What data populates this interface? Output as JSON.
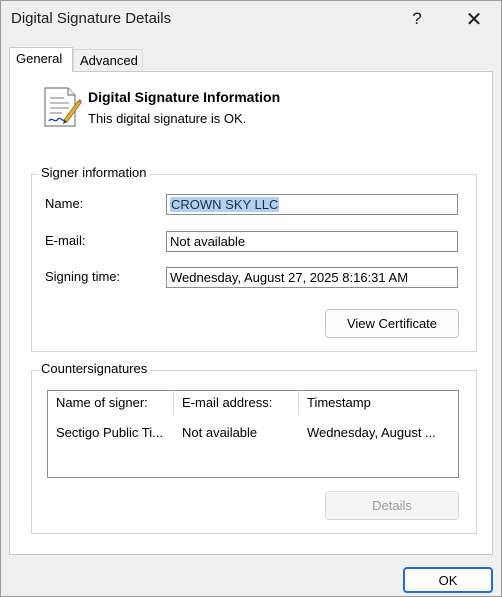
{
  "window": {
    "title": "Digital Signature Details",
    "help_glyph": "?",
    "close_glyph": "✕"
  },
  "tabs": [
    {
      "label": "General",
      "active": true
    },
    {
      "label": "Advanced",
      "active": false
    }
  ],
  "info": {
    "icon": "certificate-document-icon",
    "heading": "Digital Signature Information",
    "status": "This digital signature is OK."
  },
  "signer": {
    "group_label": "Signer information",
    "name_label": "Name:",
    "name_value": "CROWN SKY LLC",
    "email_label": "E-mail:",
    "email_value": "Not available",
    "time_label": "Signing time:",
    "time_value": "Wednesday, August 27, 2025 8:16:31 AM",
    "view_button": "View Certificate"
  },
  "countersignatures": {
    "group_label": "Countersignatures",
    "columns": [
      "Name of signer:",
      "E-mail address:",
      "Timestamp"
    ],
    "rows": [
      [
        "Sectigo Public Ti...",
        "Not available",
        "Wednesday, August ..."
      ]
    ],
    "details_button": "Details"
  },
  "footer": {
    "ok_button": "OK"
  },
  "colors": {
    "accent": "#2a6cc4",
    "selection": "#b3d0ee"
  }
}
